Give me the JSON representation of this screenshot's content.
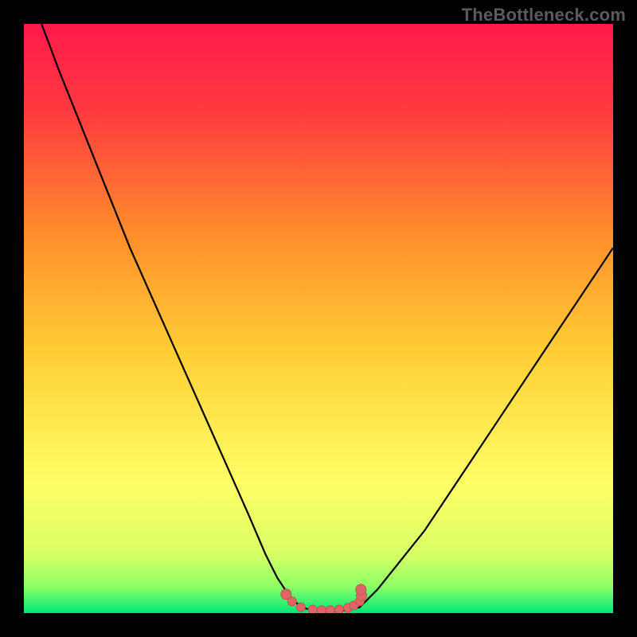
{
  "attribution": "TheBottleneck.com",
  "colors": {
    "frame": "#000000",
    "gradient_top": "#ff1a4b",
    "gradient_mid": "#ffcc33",
    "gradient_low": "#ffff66",
    "gradient_bottom": "#00e878",
    "curve": "#000000",
    "marker_fill": "#e06666",
    "marker_stroke": "#c64f4f"
  },
  "chart_data": {
    "type": "line",
    "title": "",
    "xlabel": "",
    "ylabel": "",
    "xlim": [
      0,
      100
    ],
    "ylim": [
      0,
      100
    ],
    "series": [
      {
        "name": "left-arm",
        "x": [
          3,
          6,
          10,
          14,
          18,
          22,
          26,
          30,
          34,
          38,
          41,
          43,
          45,
          47
        ],
        "y": [
          100,
          92,
          82,
          72,
          62,
          53,
          44,
          35,
          26,
          17,
          10,
          6,
          3,
          1
        ]
      },
      {
        "name": "valley-floor",
        "x": [
          47,
          49,
          51,
          53,
          55,
          57
        ],
        "y": [
          1,
          0.5,
          0.3,
          0.3,
          0.5,
          1
        ]
      },
      {
        "name": "right-arm",
        "x": [
          57,
          60,
          64,
          68,
          72,
          76,
          80,
          84,
          88,
          92,
          96,
          100
        ],
        "y": [
          1,
          4,
          9,
          14,
          20,
          26,
          32,
          38,
          44,
          50,
          56,
          62
        ]
      }
    ],
    "markers": {
      "name": "valley-markers",
      "x": [
        44.5,
        45.5,
        47,
        49,
        50.5,
        52,
        53.5,
        55,
        56,
        57,
        57.3,
        57.2
      ],
      "y": [
        3.2,
        2.0,
        1.0,
        0.6,
        0.5,
        0.5,
        0.6,
        0.9,
        1.3,
        2.0,
        3.0,
        4.0
      ]
    },
    "gradient_stops": [
      {
        "offset": 0.0,
        "color": "#ff1a4b"
      },
      {
        "offset": 0.15,
        "color": "#ff3b3f"
      },
      {
        "offset": 0.35,
        "color": "#ff8b2b"
      },
      {
        "offset": 0.55,
        "color": "#ffcc33"
      },
      {
        "offset": 0.78,
        "color": "#ffff66"
      },
      {
        "offset": 0.9,
        "color": "#d8ff66"
      },
      {
        "offset": 0.955,
        "color": "#8cff66"
      },
      {
        "offset": 1.0,
        "color": "#00e878"
      }
    ]
  }
}
